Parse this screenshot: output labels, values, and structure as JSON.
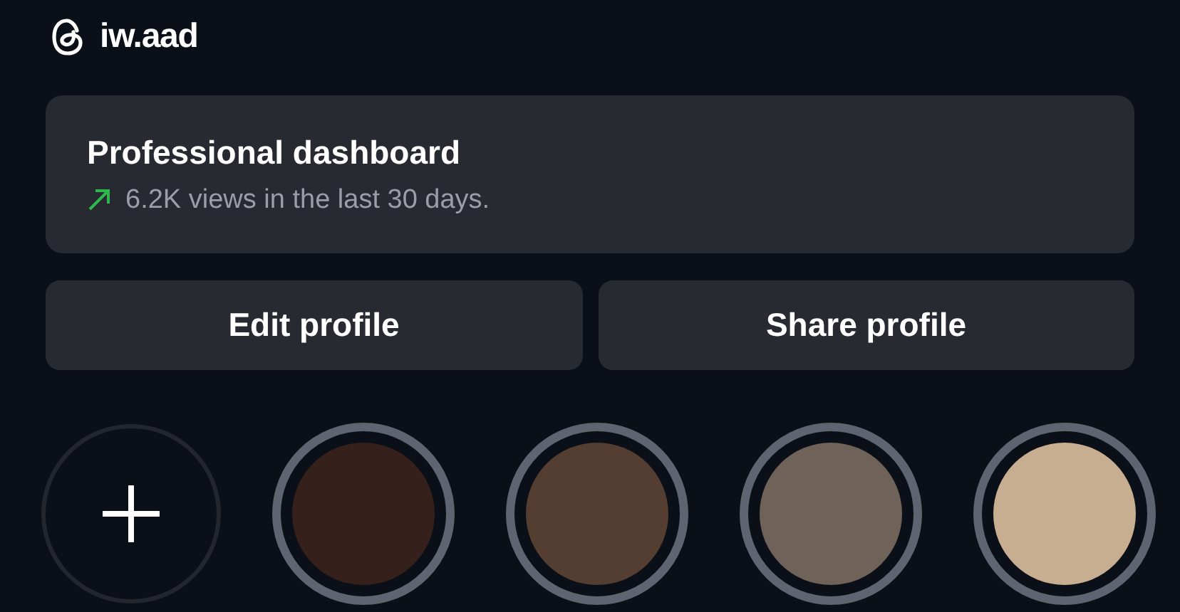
{
  "profile": {
    "username": "iw.aad"
  },
  "dashboard": {
    "title": "Professional dashboard",
    "stat": "6.2K views in the last 30 days."
  },
  "buttons": [
    "Edit profile",
    "Share profile"
  ],
  "highlights": [
    {
      "kind": "add"
    },
    {
      "kind": "cover",
      "color": "#35201c"
    },
    {
      "kind": "cover",
      "color": "#543e31"
    },
    {
      "kind": "cover",
      "color": "#6e6259"
    },
    {
      "kind": "cover",
      "color": "#c8ae90"
    }
  ]
}
